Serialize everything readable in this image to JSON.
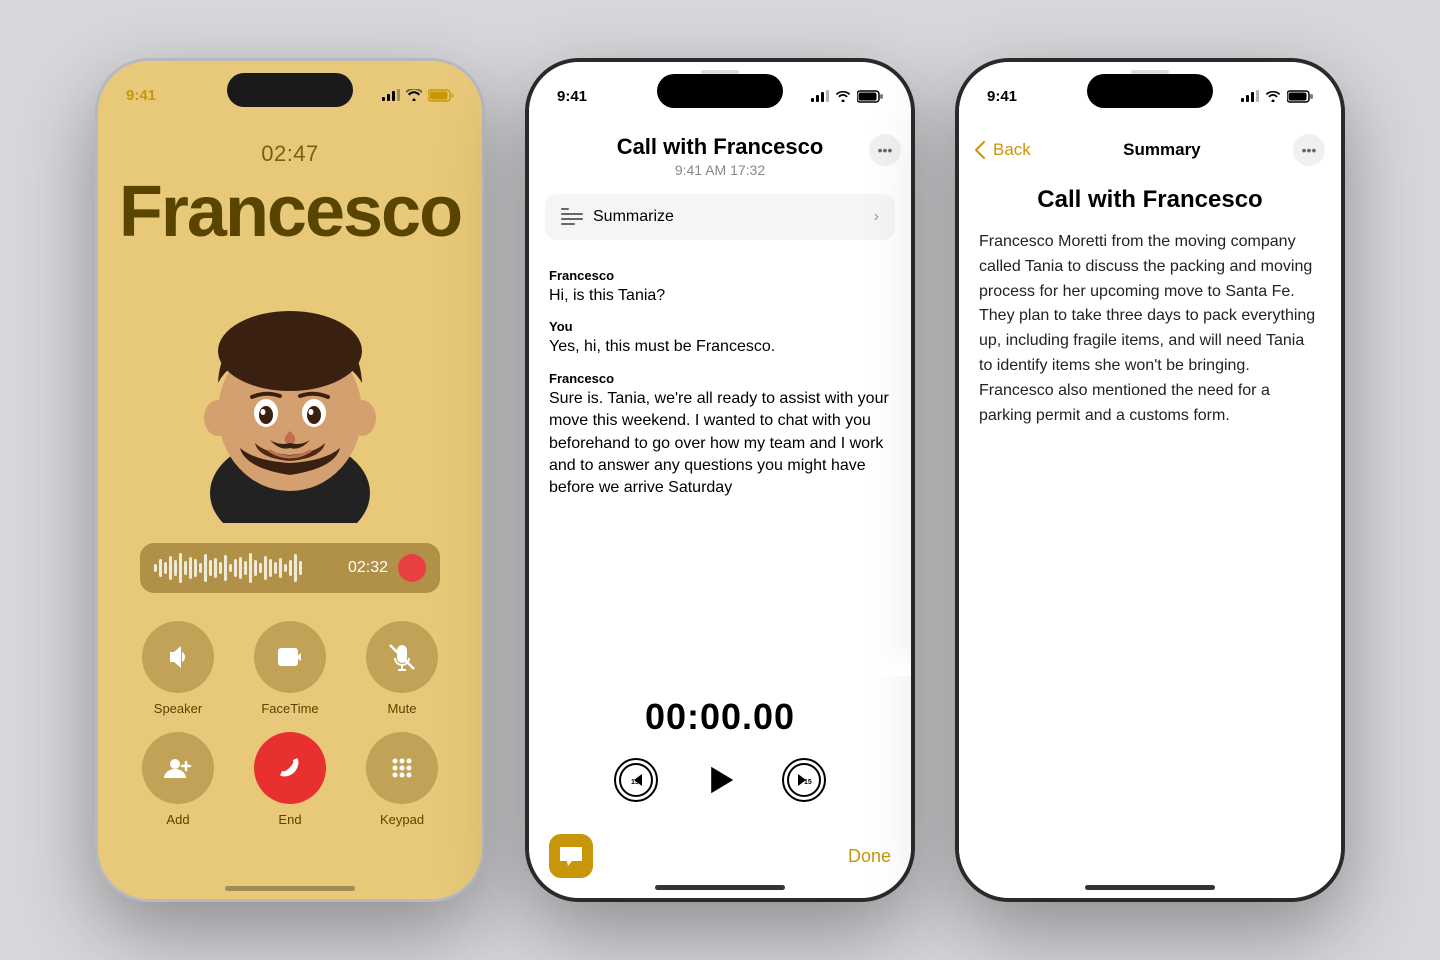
{
  "background": "#d8d8dc",
  "phone1": {
    "status_time": "9:41",
    "status_time_color": "#c8960a",
    "call_timer": "02:47",
    "caller_name": "Francesco",
    "recording_time": "02:32",
    "controls": [
      {
        "icon": "🔊",
        "label": "Speaker"
      },
      {
        "icon": "📹",
        "label": "FaceTime"
      },
      {
        "icon": "🎤",
        "label": "Mute"
      }
    ],
    "bottom_controls": [
      {
        "icon": "👤",
        "label": "Add"
      },
      {
        "icon": "📞",
        "label": "End",
        "type": "end"
      },
      {
        "icon": "⌨️",
        "label": "Keypad"
      }
    ]
  },
  "phone2": {
    "status_time": "9:41",
    "title": "Call with Francesco",
    "subtitle": "9:41 AM  17:32",
    "more_btn": "•••",
    "summarize_label": "Summarize",
    "transcript": [
      {
        "speaker": "Francesco",
        "text": "Hi, is this Tania?"
      },
      {
        "speaker": "You",
        "text": "Yes, hi, this must be Francesco."
      },
      {
        "speaker": "Francesco",
        "text": "Sure is. Tania, we're all ready to assist with your move this weekend. I wanted to chat with you beforehand to go over how my team and I work and to answer any questions you might have before we arrive Saturday"
      }
    ],
    "playback_time": "00:00.00",
    "done_label": "Done"
  },
  "phone3": {
    "status_time": "9:41",
    "back_label": "Back",
    "nav_title": "Summary",
    "more_btn": "•••",
    "call_title": "Call with Francesco",
    "summary": "Francesco Moretti from the moving company called Tania to discuss the packing and moving process for her upcoming move to Santa Fe. They plan to take three days to pack everything up, including fragile items, and will need Tania to identify items she won't be bringing. Francesco also mentioned the need for a parking permit and a customs form."
  },
  "icons": {
    "signal": "▂▄▆",
    "wifi": "wifi",
    "battery": "battery"
  }
}
